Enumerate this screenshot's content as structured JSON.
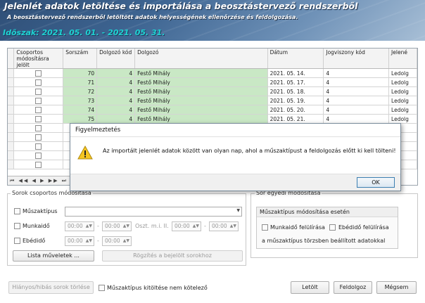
{
  "banner": {
    "title": "Jelenlét adatok letöltése és importálása a beosztástervező rendszerből",
    "subtitle": "A beosztástervező rendszerből letöltött adatok helyességének ellenőrzése és feldolgozása.",
    "period": "Időszak: 2021. 05. 01. - 2021. 05. 31."
  },
  "grid": {
    "headers": [
      "Csoportos módosításra jelölt",
      "Sorszám",
      "Dolgozó kód",
      "Dolgozó",
      "Dátum",
      "Jogviszony kód",
      "Jelené"
    ],
    "rows": [
      {
        "sorszam": "70",
        "kod": "4",
        "dolgozo": "Festő Mihály",
        "datum": "2021. 05. 14.",
        "jog": "4",
        "jel": "Ledolg"
      },
      {
        "sorszam": "71",
        "kod": "4",
        "dolgozo": "Festő Mihály",
        "datum": "2021. 05. 17.",
        "jog": "4",
        "jel": "Ledolg"
      },
      {
        "sorszam": "72",
        "kod": "4",
        "dolgozo": "Festő Mihály",
        "datum": "2021. 05. 18.",
        "jog": "4",
        "jel": "Ledolg"
      },
      {
        "sorszam": "73",
        "kod": "4",
        "dolgozo": "Festő Mihály",
        "datum": "2021. 05. 19.",
        "jog": "4",
        "jel": "Ledolg"
      },
      {
        "sorszam": "74",
        "kod": "4",
        "dolgozo": "Festő Mihály",
        "datum": "2021. 05. 20.",
        "jog": "4",
        "jel": "Ledolg"
      },
      {
        "sorszam": "75",
        "kod": "4",
        "dolgozo": "Festő Mihály",
        "datum": "2021. 05. 21.",
        "jog": "4",
        "jel": "Ledolg"
      },
      {
        "sorszam": "",
        "kod": "",
        "dolgozo": "",
        "datum": "",
        "jog": "",
        "jel": ""
      },
      {
        "sorszam": "",
        "kod": "",
        "dolgozo": "",
        "datum": "",
        "jog": "",
        "jel": ""
      },
      {
        "sorszam": "",
        "kod": "",
        "dolgozo": "",
        "datum": "",
        "jog": "",
        "jel": ""
      },
      {
        "sorszam": "",
        "kod": "",
        "dolgozo": "",
        "datum": "",
        "jog": "",
        "jel": ""
      },
      {
        "sorszam": "",
        "kod": "",
        "dolgozo": "",
        "datum": "",
        "jog": "",
        "jel": ""
      }
    ],
    "nav": "⏮ ◀◀ ◀ ▶ ▶▶ ⏭"
  },
  "sorok": {
    "title": "Sorok csoportos módosítása",
    "muszaktipus": "Műszaktípus",
    "munkaido": "Munkaidő",
    "ebedido": "Ebédidő",
    "time_placeholder": "00:00",
    "oszt_label": "Oszt. m.i. II.",
    "dash": "-",
    "lista_btn": "Lista műveletek ...",
    "rogzites_btn": "Rögzítés a bejelölt sorokhoz"
  },
  "beallitasok": {
    "title": "Sor egyedi módosítása",
    "sub_title": "Műszaktípus módosítása esetén",
    "munkaido_fel": "Munkaidő felülírása",
    "ebedido_fel": "Ebédidő felülírása",
    "torzs": "a műszaktípus törzsben beállított adatokkal"
  },
  "footer": {
    "hianyos_btn": "Hiányos/hibás sorok törlése",
    "muszak_chk": "Műszaktípus kitöltése nem kötelező",
    "letolt_btn": "Letölt",
    "feldolgoz_btn": "Feldolgoz",
    "megsem_btn": "Mégsem"
  },
  "dialog": {
    "title": "Figyelmeztetés",
    "message": "Az importált jelenlét adatok között van olyan nap, ahol a műszaktípust a feldolgozás előtt ki kell tölteni!",
    "ok": "OK"
  },
  "colors": {
    "row_green": "#c9e8c5",
    "period_cyan": "#1ed3d3"
  }
}
